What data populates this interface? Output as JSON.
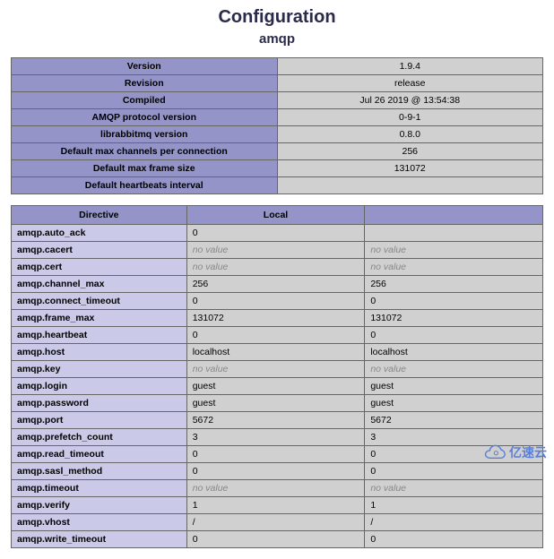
{
  "page": {
    "title": "Configuration",
    "module": "amqp"
  },
  "info": [
    {
      "label": "Version",
      "value": "1.9.4"
    },
    {
      "label": "Revision",
      "value": "release"
    },
    {
      "label": "Compiled",
      "value": "Jul 26 2019 @ 13:54:38"
    },
    {
      "label": "AMQP protocol version",
      "value": "0-9-1"
    },
    {
      "label": "librabbitmq version",
      "value": "0.8.0"
    },
    {
      "label": "Default max channels per connection",
      "value": "256"
    },
    {
      "label": "Default max frame size",
      "value": "131072"
    },
    {
      "label": "Default heartbeats interval",
      "value": ""
    }
  ],
  "directives_header": {
    "directive": "Directive",
    "local": "Local",
    "master": ""
  },
  "directives": [
    {
      "name": "amqp.auto_ack",
      "local": "0",
      "master": ""
    },
    {
      "name": "amqp.cacert",
      "local": "no value",
      "master": "no value"
    },
    {
      "name": "amqp.cert",
      "local": "no value",
      "master": "no value"
    },
    {
      "name": "amqp.channel_max",
      "local": "256",
      "master": "256"
    },
    {
      "name": "amqp.connect_timeout",
      "local": "0",
      "master": "0"
    },
    {
      "name": "amqp.frame_max",
      "local": "131072",
      "master": "131072"
    },
    {
      "name": "amqp.heartbeat",
      "local": "0",
      "master": "0"
    },
    {
      "name": "amqp.host",
      "local": "localhost",
      "master": "localhost"
    },
    {
      "name": "amqp.key",
      "local": "no value",
      "master": "no value"
    },
    {
      "name": "amqp.login",
      "local": "guest",
      "master": "guest"
    },
    {
      "name": "amqp.password",
      "local": "guest",
      "master": "guest"
    },
    {
      "name": "amqp.port",
      "local": "5672",
      "master": "5672"
    },
    {
      "name": "amqp.prefetch_count",
      "local": "3",
      "master": "3"
    },
    {
      "name": "amqp.read_timeout",
      "local": "0",
      "master": "0"
    },
    {
      "name": "amqp.sasl_method",
      "local": "0",
      "master": "0"
    },
    {
      "name": "amqp.timeout",
      "local": "no value",
      "master": "no value"
    },
    {
      "name": "amqp.verify",
      "local": "1",
      "master": "1"
    },
    {
      "name": "amqp.vhost",
      "local": "/",
      "master": "/"
    },
    {
      "name": "amqp.write_timeout",
      "local": "0",
      "master": "0"
    }
  ],
  "watermark": "亿速云"
}
